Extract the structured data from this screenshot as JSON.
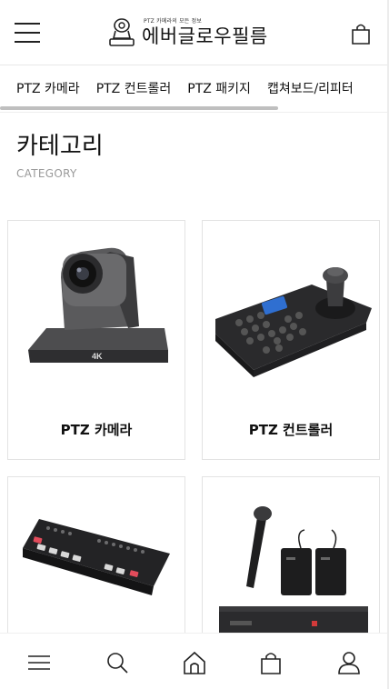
{
  "header": {
    "logo_tagline": "PTZ 카메라의 모든 정보",
    "logo_name": "에버글로우필름"
  },
  "category_nav": {
    "items": [
      "PTZ 카메라",
      "PTZ 컨트롤러",
      "PTZ 패키지",
      "캡쳐보드/리피터"
    ]
  },
  "page": {
    "title": "카테고리",
    "subtitle": "CATEGORY"
  },
  "categories": [
    {
      "label": "PTZ 카메라",
      "image": "ptz-camera"
    },
    {
      "label": "PTZ 컨트롤러",
      "image": "ptz-controller"
    },
    {
      "label": "",
      "image": "video-switcher"
    },
    {
      "label": "",
      "image": "wireless-microphone"
    }
  ],
  "bottom_nav": {
    "icons": [
      "menu-icon",
      "search-icon",
      "home-icon",
      "cart-icon",
      "user-icon"
    ]
  }
}
